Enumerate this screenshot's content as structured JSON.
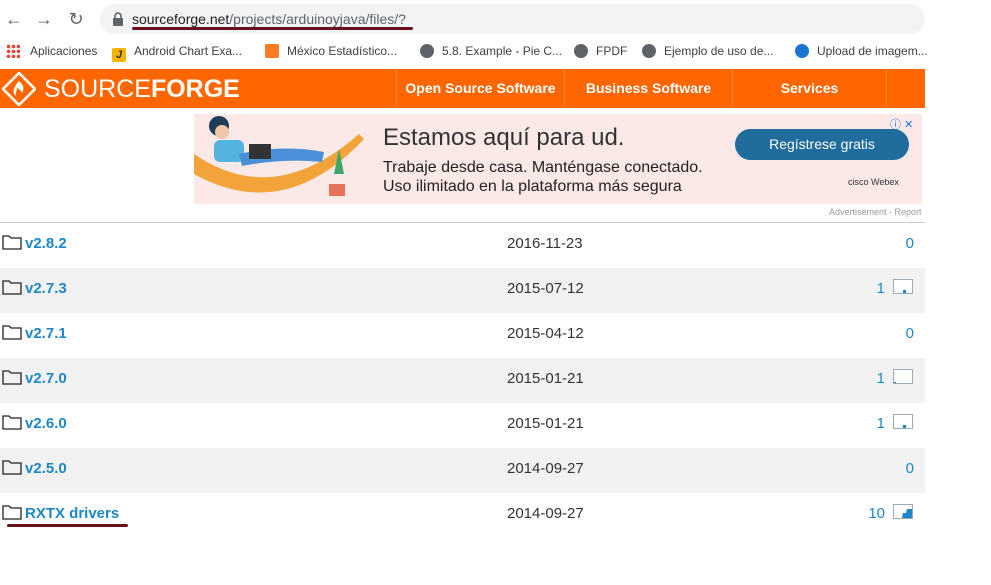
{
  "browser": {
    "url_host": "sourceforge.net",
    "url_path": "/projects/arduinoyjava/files/?",
    "bookmarks": [
      {
        "label": "Aplicaciones",
        "icon": "apps-grid-icon"
      },
      {
        "label": "Android Chart Exa...",
        "icon": "j-favicon-icon"
      },
      {
        "label": "México Estadístico...",
        "icon": "xampp-favicon-icon"
      },
      {
        "label": "5.8. Example - Pie C...",
        "icon": "globe-icon"
      },
      {
        "label": "FPDF",
        "icon": "globe-icon"
      },
      {
        "label": "Ejemplo de uso de...",
        "icon": "globe-icon"
      },
      {
        "label": "Upload de imagem...",
        "icon": "upload-favicon-icon"
      }
    ]
  },
  "header": {
    "logo_light": "SOURCE",
    "logo_bold": "FORGE",
    "nav": [
      {
        "label": "Open Source Software"
      },
      {
        "label": "Business Software"
      },
      {
        "label": "Services"
      }
    ],
    "accent_color": "#ff6600"
  },
  "ad": {
    "headline": "Estamos aquí para ud.",
    "line1": "Trabaje desde casa. Manténgase conectado.",
    "line2": "Uso ilimitado en la plataforma más segura",
    "cta": "Regístrese gratis",
    "brand": "cisco Webex",
    "note": "Advertisement - Report"
  },
  "files": [
    {
      "name": "v2.8.2",
      "date": "2016-11-23",
      "downloads": "0",
      "chart": false
    },
    {
      "name": "v2.7.3",
      "date": "2015-07-12",
      "downloads": "1",
      "chart": true
    },
    {
      "name": "v2.7.1",
      "date": "2015-04-12",
      "downloads": "0",
      "chart": false
    },
    {
      "name": "v2.7.0",
      "date": "2015-01-21",
      "downloads": "1",
      "chart": true
    },
    {
      "name": "v2.6.0",
      "date": "2015-01-21",
      "downloads": "1",
      "chart": true
    },
    {
      "name": "v2.5.0",
      "date": "2014-09-27",
      "downloads": "0",
      "chart": false
    },
    {
      "name": "RXTX drivers",
      "date": "2014-09-27",
      "downloads": "10",
      "chart": true
    }
  ]
}
